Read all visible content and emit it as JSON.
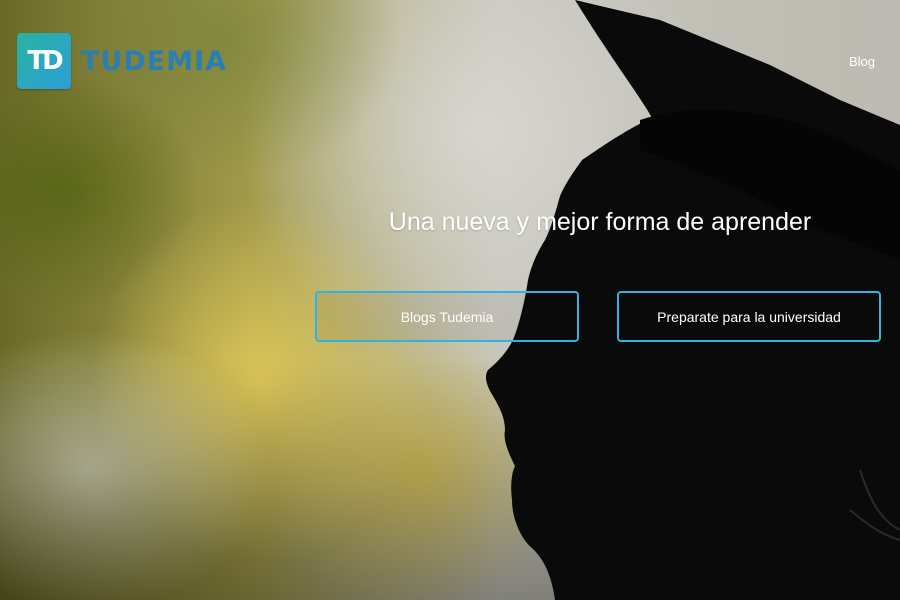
{
  "brand": {
    "mark": "TD",
    "name": "TUDEMIA",
    "accent_color": "#2a7fb0"
  },
  "nav": {
    "blog_label": "Blog"
  },
  "hero": {
    "tagline": "Una nueva y mejor forma de aprender",
    "buttons": [
      {
        "label": "Blogs Tudemia"
      },
      {
        "label": "Preparate para la universidad"
      }
    ],
    "button_border_color": "#2fb4e0"
  }
}
